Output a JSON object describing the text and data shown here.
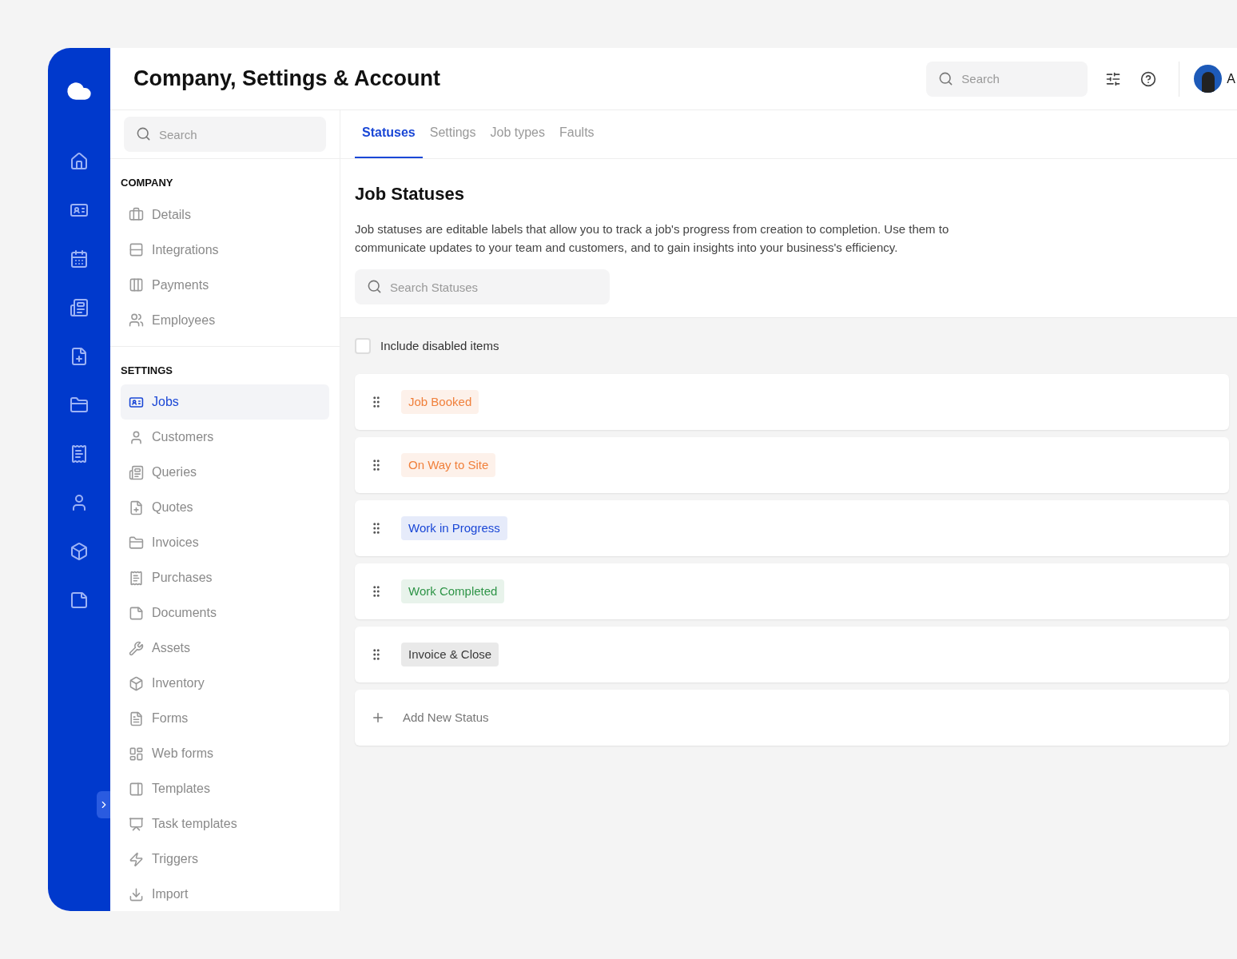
{
  "header": {
    "title": "Company, Settings & Account",
    "search": {
      "placeholder": "Search"
    },
    "user_initial": "A"
  },
  "sidebar": {
    "search": {
      "placeholder": "Search"
    },
    "sections": [
      {
        "heading": "COMPANY",
        "items": [
          {
            "label": "Details",
            "selected": false
          },
          {
            "label": "Integrations",
            "selected": false
          },
          {
            "label": "Payments",
            "selected": false
          },
          {
            "label": "Employees",
            "selected": false
          }
        ]
      },
      {
        "heading": "SETTINGS",
        "items": [
          {
            "label": "Jobs",
            "selected": true
          },
          {
            "label": "Customers",
            "selected": false
          },
          {
            "label": "Queries",
            "selected": false
          },
          {
            "label": "Quotes",
            "selected": false
          },
          {
            "label": "Invoices",
            "selected": false
          },
          {
            "label": "Purchases",
            "selected": false
          },
          {
            "label": "Documents",
            "selected": false
          },
          {
            "label": "Assets",
            "selected": false
          },
          {
            "label": "Inventory",
            "selected": false
          },
          {
            "label": "Forms",
            "selected": false
          },
          {
            "label": "Web forms",
            "selected": false
          },
          {
            "label": "Templates",
            "selected": false
          },
          {
            "label": "Task templates",
            "selected": false
          },
          {
            "label": "Triggers",
            "selected": false
          },
          {
            "label": "Import",
            "selected": false
          }
        ]
      }
    ]
  },
  "tabs": [
    {
      "label": "Statuses",
      "selected": true
    },
    {
      "label": "Settings",
      "selected": false
    },
    {
      "label": "Job types",
      "selected": false
    },
    {
      "label": "Faults",
      "selected": false
    }
  ],
  "page": {
    "title": "Job Statuses",
    "description": "Job statuses are editable labels that allow you to track a job's progress from creation to completion. Use them to communicate updates to your team and customers, and to gain insights into your business's efficiency.",
    "search": {
      "placeholder": "Search Statuses"
    }
  },
  "include_disabled": {
    "label": "Include disabled items",
    "checked": false
  },
  "statuses": [
    {
      "label": "Job Booked",
      "color": "#f0803c"
    },
    {
      "label": "On Way to Site",
      "color": "#f0803c"
    },
    {
      "label": "Work in Progress",
      "color": "#1a47d6"
    },
    {
      "label": "Work Completed",
      "color": "#2e9447"
    },
    {
      "label": "Invoice & Close",
      "color": "#3a3a3a"
    }
  ],
  "add_status": {
    "label": "Add New Status"
  }
}
